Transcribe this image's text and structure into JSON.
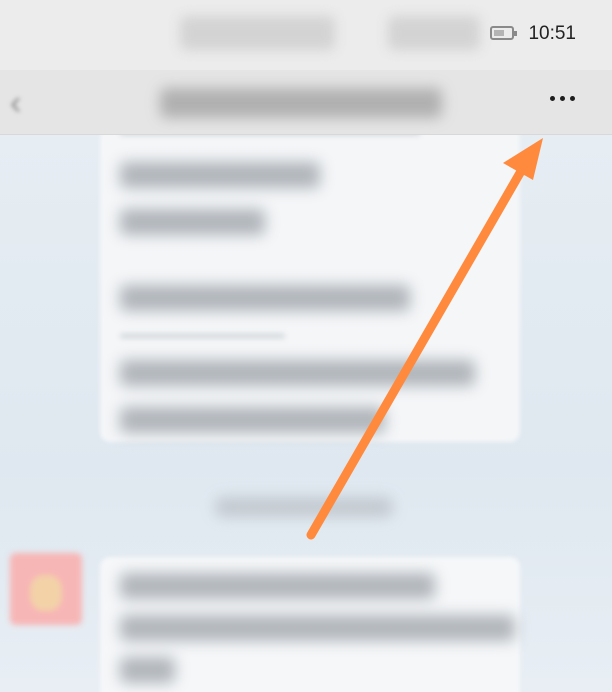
{
  "status_bar": {
    "time": "10:51"
  },
  "header": {
    "more_icon": "more-horizontal-icon",
    "back_icon": "chevron-left-icon"
  },
  "colors": {
    "arrow": "#ff8a3d",
    "header_bg": "#e5e5e5",
    "chat_bg": "#e6edf3"
  }
}
